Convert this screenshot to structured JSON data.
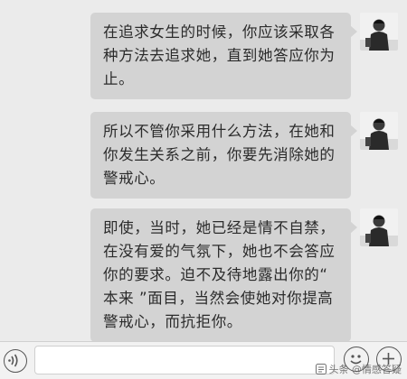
{
  "messages": [
    {
      "text": "在追求女生的时候，你应该采取各\n种方法去追求她，直到她答应你为\n止。",
      "sender": "me",
      "avatar_icon": "user-avatar-icon"
    },
    {
      "text": "所以不管你采用什么方法，在她和\n你发生关系之前，你要先消除她的\n警戒心。",
      "sender": "me",
      "avatar_icon": "user-avatar-icon"
    },
    {
      "text": "即使，当时，她已经是情不自禁，\n在没有爱的气氛下，她也不会答应\n你的要求。迫不及待地露出你的“\n本来 ”面目，当然会使她对你提高\n警戒心，而抗拒你。",
      "sender": "me",
      "avatar_icon": "user-avatar-icon"
    }
  ],
  "input_bar": {
    "voice_icon": "voice-icon",
    "input_value": "",
    "emoji_icon": "emoji-icon",
    "plus_icon": "plus-icon"
  },
  "watermark": {
    "text": "头条 @情感答疑",
    "icon": "toutiao-logo-icon"
  },
  "colors": {
    "background": "#ebebeb",
    "bubble": "#d3d3d3",
    "text": "#2b2b2b"
  }
}
